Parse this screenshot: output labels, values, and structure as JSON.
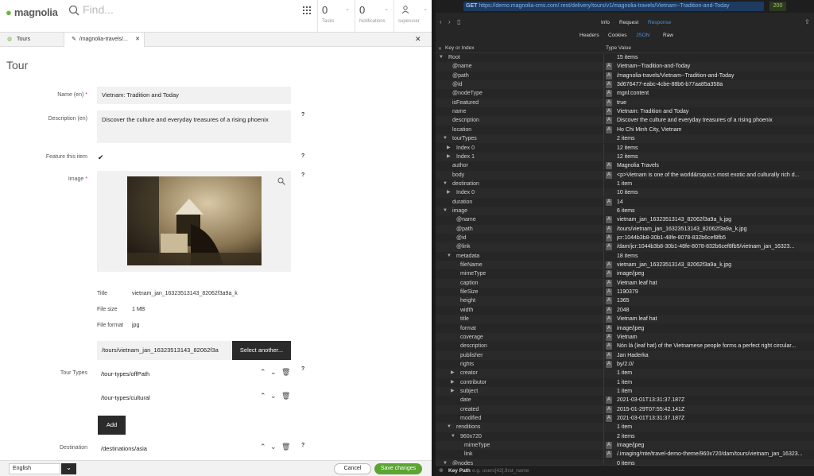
{
  "header": {
    "logo": "magnolia",
    "search_placeholder": "Find...",
    "tasks_count": "0",
    "tasks_label": "Tasks",
    "notifications_count": "0",
    "notifications_label": "Notifications",
    "user_label": "superuser"
  },
  "tabs": [
    {
      "label": "Tours"
    },
    {
      "label": "/magnolia-travels/..."
    }
  ],
  "form": {
    "title": "Tour",
    "name_label": "Name (en)",
    "name_value": "Vietnam: Tradition and Today",
    "description_label": "Description (en)",
    "description_value": "Discover the culture and everyday treasures of a rising phoenix",
    "feature_label": "Feature this item",
    "image_label": "Image",
    "help": "?",
    "required_mark": "*",
    "meta": {
      "title_label": "Title",
      "title_value": "vietnam_jan_16323513143_82062f3a9a_k",
      "size_label": "File size",
      "size_value": "1 MB",
      "format_label": "File format",
      "format_value": "jpg"
    },
    "image_path": "/tours/vietnam_jan_16323513143_82062f3a",
    "select_another": "Select another...",
    "tour_types_label": "Tour Types",
    "tour_types": [
      "/tour-types/offPath",
      "/tour-types/cultural"
    ],
    "add_label": "Add",
    "destination_label": "Destination",
    "destination_value": "/destinations/asia"
  },
  "footer": {
    "language": "English",
    "cancel": "Cancel",
    "save": "Save changes"
  },
  "dev": {
    "method": "GET",
    "url": "https://demo.magnolia-cms.com/.rest/delivery/tours/v1/magnolia-travels/Vietnam--Tradition-and-Today",
    "status": "200",
    "tabs": [
      "Info",
      "Request",
      "Response"
    ],
    "subtabs": [
      "Headers",
      "Cookies",
      "JSON",
      "Raw"
    ],
    "col_key": "Key or Index",
    "col_type_value": "Type Value",
    "keypath_label": "Key Path",
    "keypath_placeholder": "e.g. users[42].first_name",
    "rows": [
      {
        "k": "Root",
        "d": 0,
        "t": "",
        "v": "15 items",
        "tri": "open"
      },
      {
        "k": "@name",
        "d": 1,
        "t": "A",
        "v": "Vietnam--Tradition-and-Today"
      },
      {
        "k": "@path",
        "d": 1,
        "t": "A",
        "v": "/magnolia-travels/Vietnam--Tradition-and-Today"
      },
      {
        "k": "@id",
        "d": 1,
        "t": "A",
        "v": "3d676477-eabc-4cbe-88b6-b77aa85a358a"
      },
      {
        "k": "@nodeType",
        "d": 1,
        "t": "A",
        "v": "mgnl:content"
      },
      {
        "k": "isFeatured",
        "d": 1,
        "t": "A",
        "v": "true"
      },
      {
        "k": "name",
        "d": 1,
        "t": "A",
        "v": "Vietnam: Tradition and Today"
      },
      {
        "k": "description",
        "d": 1,
        "t": "A",
        "v": "Discover the culture and everyday treasures of a rising phoenix"
      },
      {
        "k": "location",
        "d": 1,
        "t": "A",
        "v": "Ho Chi Minh City, Vietnam"
      },
      {
        "k": "tourTypes",
        "d": 1,
        "t": "",
        "v": "2 items",
        "tri": "open"
      },
      {
        "k": "Index 0",
        "d": 2,
        "t": "",
        "v": "12 items",
        "tri": "closed"
      },
      {
        "k": "Index 1",
        "d": 2,
        "t": "",
        "v": "12 items",
        "tri": "closed"
      },
      {
        "k": "author",
        "d": 1,
        "t": "A",
        "v": "Magnolia Travels"
      },
      {
        "k": "body",
        "d": 1,
        "t": "A",
        "v": "<p>Vietnam is one of the world&rsquo;s most exotic and culturally rich d..."
      },
      {
        "k": "destination",
        "d": 1,
        "t": "",
        "v": "1 item",
        "tri": "open"
      },
      {
        "k": "Index 0",
        "d": 2,
        "t": "",
        "v": "10 items",
        "tri": "closed"
      },
      {
        "k": "duration",
        "d": 1,
        "t": "A",
        "v": "14"
      },
      {
        "k": "image",
        "d": 1,
        "t": "",
        "v": "6 items",
        "tri": "open"
      },
      {
        "k": "@name",
        "d": 2,
        "t": "A",
        "v": "vietnam_jan_16323513143_82062f3a9a_k.jpg"
      },
      {
        "k": "@path",
        "d": 2,
        "t": "A",
        "v": "/tours/vietnam_jan_16323513143_82062f3a9a_k.jpg"
      },
      {
        "k": "@id",
        "d": 2,
        "t": "A",
        "v": "jcr:1044b3b8-30b1-48fe-8078-832b6cef8fb5"
      },
      {
        "k": "@link",
        "d": 2,
        "t": "A",
        "v": "/dam/jcr:1044b3b8-30b1-48fe-8078-832b6cef8fb5/vietnam_jan_16323..."
      },
      {
        "k": "metadata",
        "d": 2,
        "t": "",
        "v": "18 items",
        "tri": "open"
      },
      {
        "k": "fileName",
        "d": 3,
        "t": "A",
        "v": "vietnam_jan_16323513143_82062f3a9a_k.jpg"
      },
      {
        "k": "mimeType",
        "d": 3,
        "t": "A",
        "v": "image/jpeg"
      },
      {
        "k": "caption",
        "d": 3,
        "t": "A",
        "v": "Vietnam leaf hat"
      },
      {
        "k": "fileSize",
        "d": 3,
        "t": "A",
        "v": "1190379"
      },
      {
        "k": "height",
        "d": 3,
        "t": "A",
        "v": "1365"
      },
      {
        "k": "width",
        "d": 3,
        "t": "A",
        "v": "2048"
      },
      {
        "k": "title",
        "d": 3,
        "t": "A",
        "v": "Vietnam leaf hat"
      },
      {
        "k": "format",
        "d": 3,
        "t": "A",
        "v": "image/jpeg"
      },
      {
        "k": "coverage",
        "d": 3,
        "t": "A",
        "v": "Vietnam"
      },
      {
        "k": "description",
        "d": 3,
        "t": "A",
        "v": "Nón lá (leaf hat) of the Vietnamese people forms a perfect right circular..."
      },
      {
        "k": "publisher",
        "d": 3,
        "t": "A",
        "v": "Jan Haderka"
      },
      {
        "k": "rights",
        "d": 3,
        "t": "A",
        "v": "by/2.0/"
      },
      {
        "k": "creator",
        "d": 3,
        "t": "",
        "v": "1 item",
        "tri": "closed"
      },
      {
        "k": "contributor",
        "d": 3,
        "t": "",
        "v": "1 item",
        "tri": "closed"
      },
      {
        "k": "subject",
        "d": 3,
        "t": "",
        "v": "1 item",
        "tri": "closed"
      },
      {
        "k": "date",
        "d": 3,
        "t": "A",
        "v": "2021-03-01T13:31:37.187Z"
      },
      {
        "k": "created",
        "d": 3,
        "t": "A",
        "v": "2015-01-29T07:55:42.141Z"
      },
      {
        "k": "modified",
        "d": 3,
        "t": "A",
        "v": "2021-03-01T13:31:37.187Z"
      },
      {
        "k": "renditions",
        "d": 2,
        "t": "",
        "v": "1 item",
        "tri": "open"
      },
      {
        "k": "960x720",
        "d": 3,
        "t": "",
        "v": "2 items",
        "tri": "open"
      },
      {
        "k": "mimeType",
        "d": 4,
        "t": "A",
        "v": "image/jpeg"
      },
      {
        "k": "link",
        "d": 4,
        "t": "A",
        "v": "/.imaging/mte/travel-demo-theme/960x720/dam/tours/vietnam_jan_16323..."
      },
      {
        "k": "@nodes",
        "d": 1,
        "t": "",
        "v": "0 items",
        "tri": "open"
      }
    ]
  },
  "colors": {
    "brand_green": "#6cb33f",
    "save_green": "#5ba532",
    "dev_bg": "#262626",
    "accent_blue": "#4a90d9"
  }
}
